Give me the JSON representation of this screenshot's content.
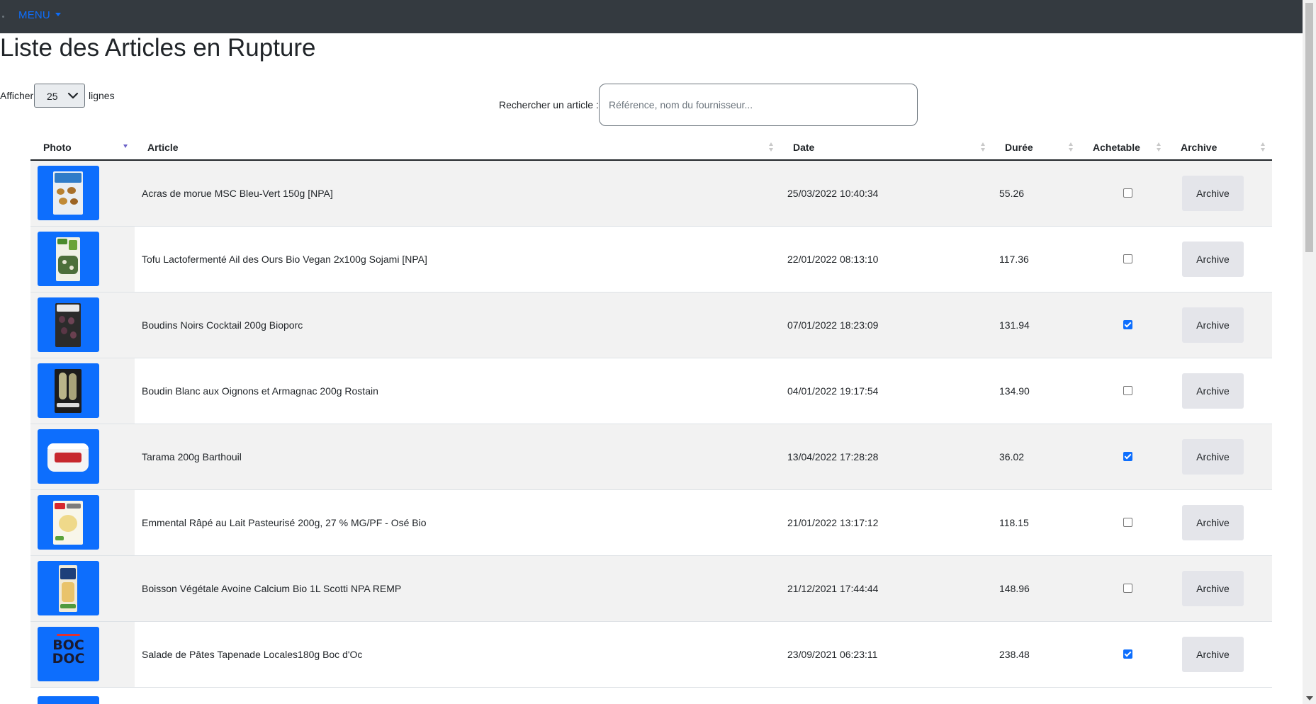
{
  "nav": {
    "menu_label": "MENU"
  },
  "page": {
    "title": "Liste des Articles en Rupture"
  },
  "length_control": {
    "prefix": "Afficher",
    "value": "25",
    "suffix": "lignes"
  },
  "search": {
    "label": "Rechercher un article :",
    "placeholder": "Référence, nom du fournisseur...",
    "value": ""
  },
  "table": {
    "columns": [
      "Photo",
      "Article",
      "Date",
      "Durée",
      "Achetable",
      "Archive"
    ],
    "archive_label": "Archive",
    "rows": [
      {
        "article": "Acras de morue MSC Bleu-Vert 150g [NPA]",
        "date": "25/03/2022 10:40:34",
        "duree": "55.26",
        "achetable": false,
        "photo_icon": "acras-pack-icon"
      },
      {
        "article": "Tofu Lactofermenté Ail des Ours Bio Vegan 2x100g Sojami [NPA]",
        "date": "22/01/2022 08:13:10",
        "duree": "117.36",
        "achetable": false,
        "photo_icon": "tofu-pack-icon"
      },
      {
        "article": "Boudins Noirs Cocktail 200g Bioporc",
        "date": "07/01/2022 18:23:09",
        "duree": "131.94",
        "achetable": true,
        "photo_icon": "boudins-pack-icon"
      },
      {
        "article": "Boudin Blanc aux Oignons et Armagnac 200g Rostain",
        "date": "04/01/2022 19:17:54",
        "duree": "134.90",
        "achetable": false,
        "photo_icon": "boudin-blanc-pack-icon"
      },
      {
        "article": "Tarama 200g Barthouil",
        "date": "13/04/2022 17:28:28",
        "duree": "36.02",
        "achetable": true,
        "photo_icon": "tarama-tub-icon"
      },
      {
        "article": "Emmental Râpé au Lait Pasteurisé 200g, 27 % MG/PF - Osé Bio",
        "date": "21/01/2022 13:17:12",
        "duree": "118.15",
        "achetable": false,
        "photo_icon": "emmental-bag-icon"
      },
      {
        "article": "Boisson Végétale Avoine Calcium Bio 1L Scotti NPA REMP",
        "date": "21/12/2021 17:44:44",
        "duree": "148.96",
        "achetable": false,
        "photo_icon": "oat-drink-carton-icon"
      },
      {
        "article": "Salade de Pâtes Tapenade Locales180g Boc d'Oc",
        "date": "23/09/2021 06:23:11",
        "duree": "238.48",
        "achetable": true,
        "photo_icon": "boc-doc-logo-icon"
      }
    ]
  },
  "logo": {
    "boc_line1": "BOC",
    "boc_line2": "DOC"
  },
  "colors": {
    "navbar": "#343a40",
    "accent": "#0d6efd",
    "archive_button": "#e4e5ea"
  }
}
